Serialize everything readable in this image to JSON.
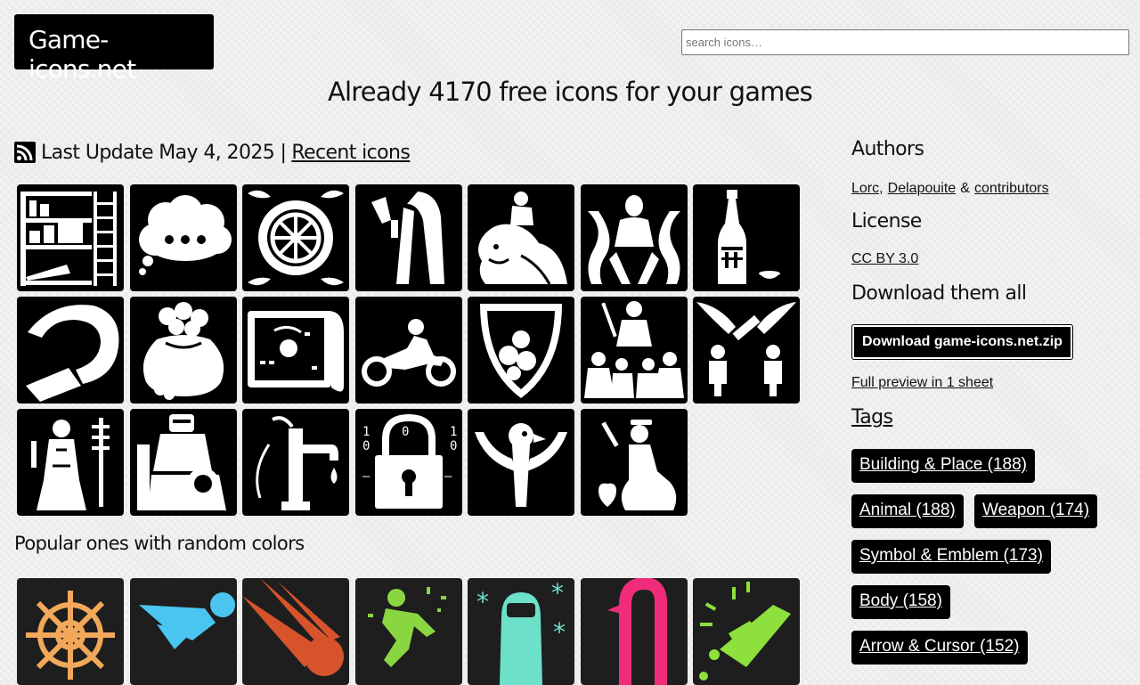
{
  "header": {
    "site_title": "Game-icons.net",
    "search_placeholder": "search icons…",
    "headline": "Already 4170 free icons for your games"
  },
  "update": {
    "rss_icon": "rss-icon",
    "text": "Last Update May 4, 2025 |",
    "recent_link": "Recent icons"
  },
  "latest_icons": [
    "bookshelf-icon",
    "thought-bubble-icon",
    "ship-wheel-shield-icon",
    "cloaked-figure-icon",
    "lion-rider-icon",
    "meditating-figure-flames-icon",
    "sake-bottle-icon",
    "hook-claw-icon",
    "treasure-sack-icon",
    "treasure-map-icon",
    "motorcycle-rider-icon",
    "bubble-shield-icon",
    "crowd-figure-icon",
    "winged-figures-icon",
    "shaman-totem-icon",
    "seated-knight-icon",
    "water-pump-icon",
    "binary-padlock-icon",
    "bird-emblem-icon",
    "seated-lady-heart-icon"
  ],
  "popular": {
    "title": "Popular ones with random colors",
    "icons": [
      {
        "name": "ship-wheel-icon",
        "color": "#f1a85a"
      },
      {
        "name": "running-ninja-icon",
        "color": "#49c5f0"
      },
      {
        "name": "comet-icon",
        "color": "#d6532c"
      },
      {
        "name": "falling-man-icon",
        "color": "#8ad640"
      },
      {
        "name": "hazmat-suit-icon",
        "color": "#6ce0c8"
      },
      {
        "name": "sea-serpent-icon",
        "color": "#f02c7a"
      },
      {
        "name": "punch-blast-icon",
        "color": "#8ee03c"
      }
    ]
  },
  "sidebar": {
    "authors_heading": "Authors",
    "author1": "Lorc,",
    "author2": "Delapouite",
    "ampersand": "&",
    "contributors": "contributors",
    "license_heading": "License",
    "license_link": "CC BY 3.0",
    "download_heading": "Download them all",
    "download_button": "Download game-icons.net.zip",
    "preview_link": "Full preview in 1 sheet",
    "tags_heading": "Tags",
    "tags": [
      "Building & Place (188)",
      "Animal (188)",
      "Weapon (174)",
      "Symbol & Emblem (173)",
      "Body (158)",
      "Arrow & Cursor (152)"
    ]
  }
}
